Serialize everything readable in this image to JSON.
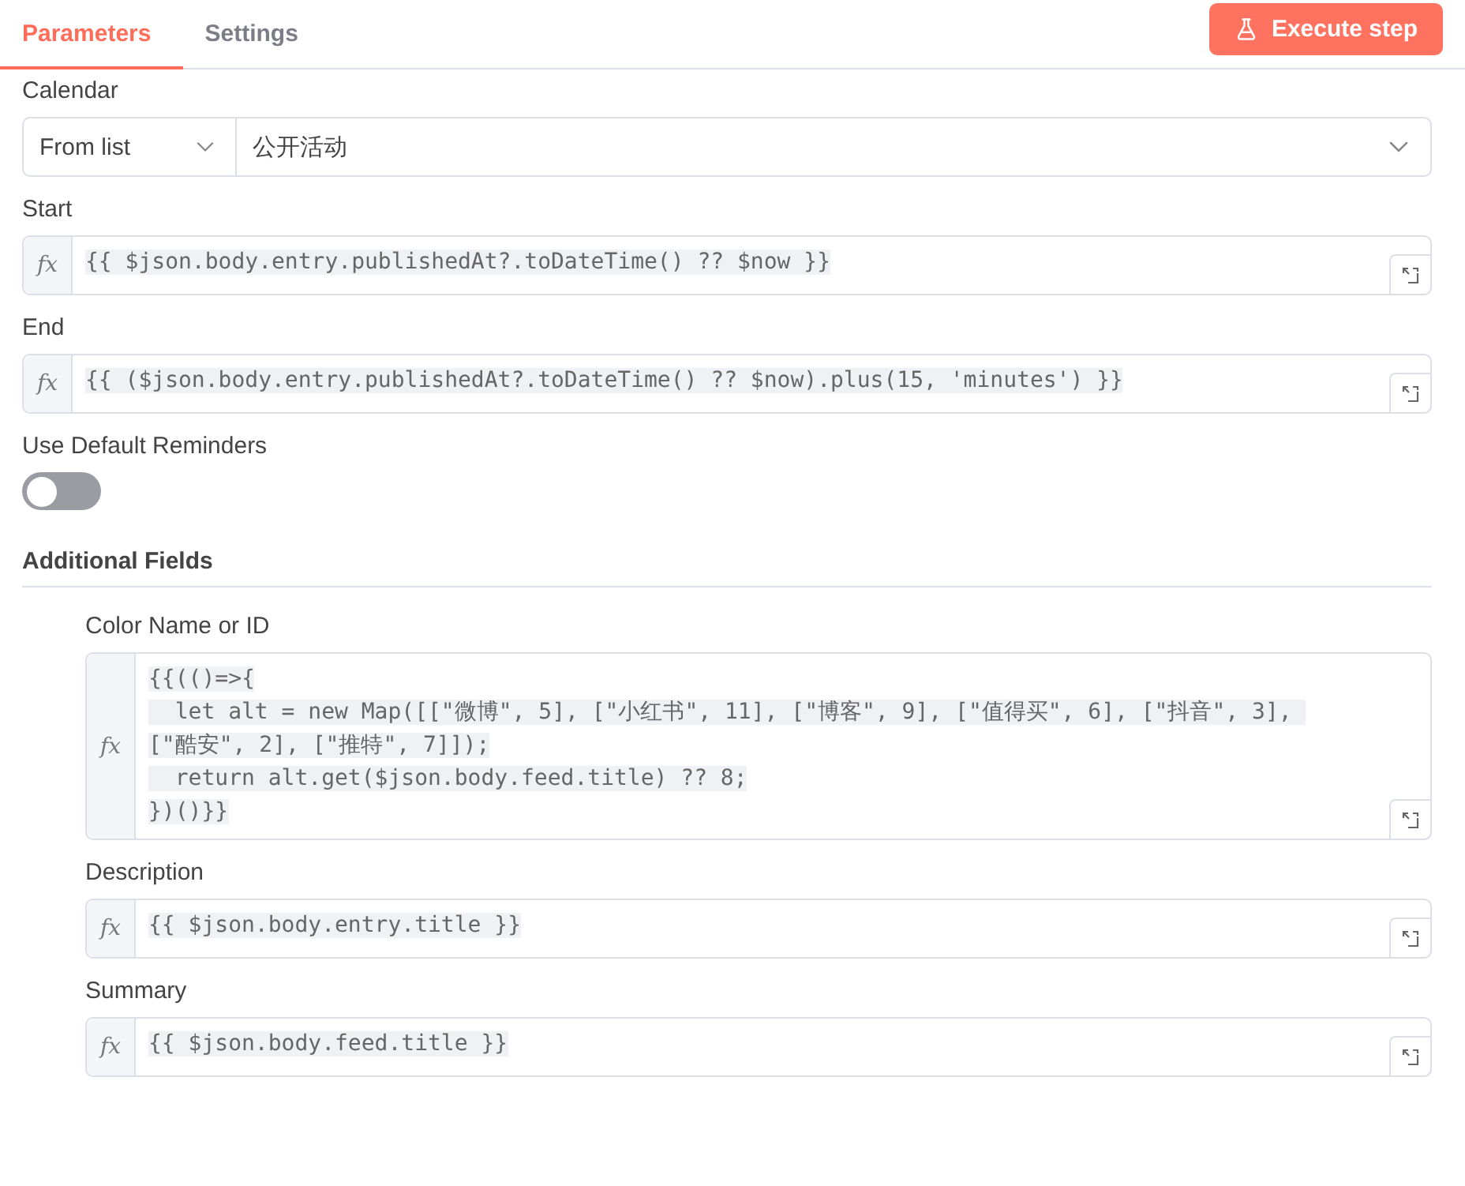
{
  "tabs": [
    {
      "label": "Parameters",
      "selected": true
    },
    {
      "label": "Settings",
      "selected": false
    }
  ],
  "execute_button": {
    "label": "Execute step"
  },
  "fields": [
    {
      "kind": "select",
      "label": "Calendar",
      "mode": "From list",
      "value": "公开活动"
    },
    {
      "kind": "expression",
      "label": "Start",
      "fx": "fx",
      "lines": [
        "{{ $json.body.entry.publishedAt?.toDateTime() ?? $now }}"
      ]
    },
    {
      "kind": "expression",
      "label": "End",
      "fx": "fx",
      "lines": [
        "{{ ($json.body.entry.publishedAt?.toDateTime() ?? $now).plus(15, 'minutes') }}"
      ]
    },
    {
      "kind": "toggle",
      "label": "Use Default Reminders",
      "on": false
    }
  ],
  "additional_fields": {
    "title": "Additional Fields",
    "fields": [
      {
        "kind": "expression",
        "label": "Color Name or ID",
        "fx": "fx",
        "lines": [
          "{{(()=>{",
          "  let alt = new Map([[\"微博\", 5], [\"小红书\", 11], [\"博客\", 9], [\"值得买\", 6], [\"抖音\", 3], [\"酷安\", 2], [\"推特\", 7]]);",
          "  return alt.get($json.body.feed.title) ?? 8;",
          "})()}}"
        ]
      },
      {
        "kind": "expression",
        "label": "Description",
        "fx": "fx",
        "lines": [
          "{{ $json.body.entry.title }}"
        ]
      },
      {
        "kind": "expression",
        "label": "Summary",
        "fx": "fx",
        "lines": [
          "{{ $json.body.feed.title }}"
        ]
      }
    ]
  }
}
